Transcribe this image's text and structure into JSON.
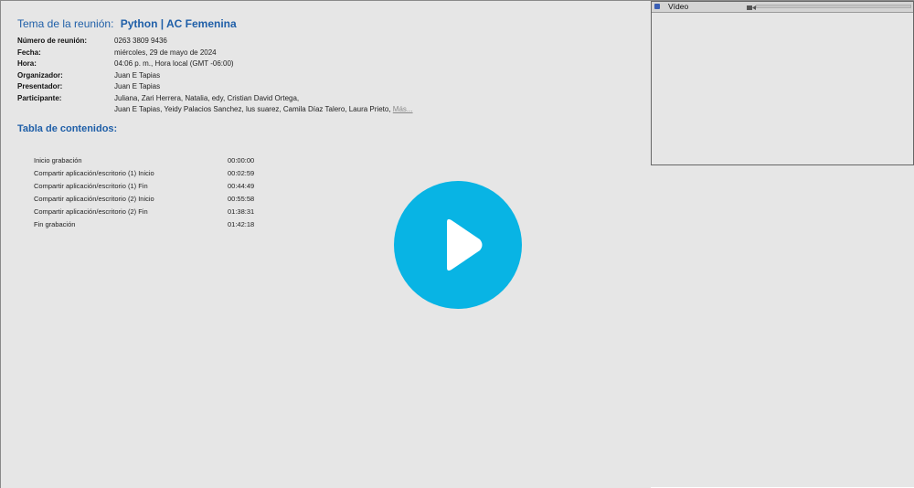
{
  "meeting": {
    "topic_label": "Tema de la reunión:",
    "topic": "Python | AC Femenina"
  },
  "info": {
    "number_label": "Número de reunión:",
    "number_value": "0263 3809 9436",
    "date_label": "Fecha:",
    "date_value": "miércoles, 29 de mayo de 2024",
    "time_label": "Hora:",
    "time_value": "04:06 p. m., Hora local (GMT -06:00)",
    "organizer_label": "Organizador:",
    "organizer_value": "Juan E Tapias",
    "presenter_label": "Presentador:",
    "presenter_value": "Juan E Tapias",
    "participants_label": "Participante:",
    "participants_line1": "Juliana,  Zari Herrera,  Natalia,  edy,  Cristian David Ortega,",
    "participants_line2": "Juan E Tapias,  Yeidy Palacios Sanchez,  lus suarez,  Camila Díaz Talero,  Laura Prieto,",
    "more_link": "Más..."
  },
  "toc": {
    "title": "Tabla de contenidos:",
    "entries": [
      {
        "name": "Inicio grabación",
        "time": "00:00:00"
      },
      {
        "name": "Compartir aplicación/escritorio (1) Inicio",
        "time": "00:02:59"
      },
      {
        "name": "Compartir aplicación/escritorio (1) Fin",
        "time": "00:44:49"
      },
      {
        "name": "Compartir aplicación/escritorio (2) Inicio",
        "time": "00:55:58"
      },
      {
        "name": "Compartir aplicación/escritorio (2) Fin",
        "time": "01:38:31"
      },
      {
        "name": "Fin grabación",
        "time": "01:42:18"
      }
    ]
  },
  "video_panel": {
    "title": "Vídeo",
    "icon": "camera-icon"
  },
  "player": {
    "icon": "play-icon",
    "color": "#08b4e4"
  },
  "colors": {
    "heading": "#1f5fa8",
    "background": "#e6e6e6"
  }
}
